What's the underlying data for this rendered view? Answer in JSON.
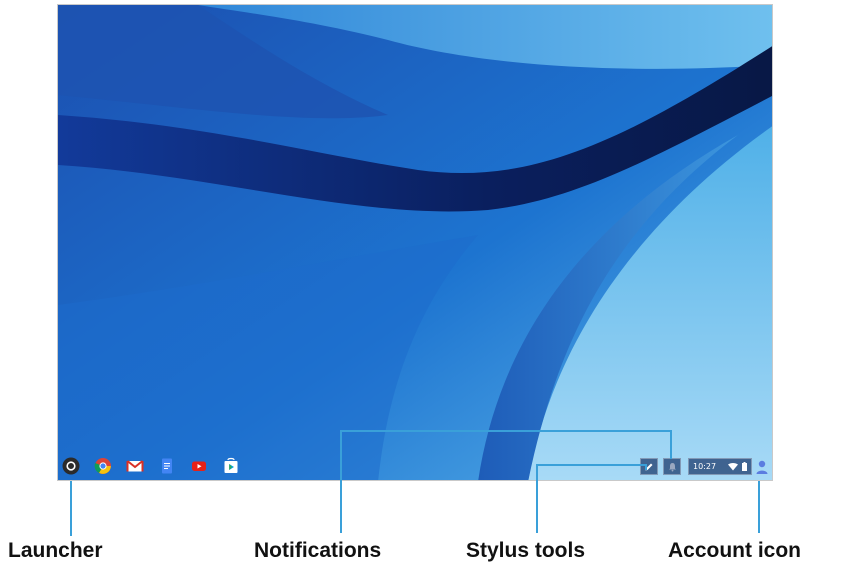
{
  "shelf": {
    "apps": [
      {
        "name": "launcher",
        "icon": "launcher-icon"
      },
      {
        "name": "chrome",
        "icon": "chrome-icon"
      },
      {
        "name": "gmail",
        "icon": "gmail-icon"
      },
      {
        "name": "docs",
        "icon": "docs-icon"
      },
      {
        "name": "youtube",
        "icon": "youtube-icon"
      },
      {
        "name": "play-store",
        "icon": "play-store-icon"
      }
    ]
  },
  "tray": {
    "stylus_icon": "pen-icon",
    "notifications_icon": "bell-icon",
    "time": "10:27",
    "wifi_icon": "wifi-icon",
    "battery_icon": "battery-icon",
    "account_icon": "person-icon"
  },
  "callouts": {
    "launcher": "Launcher",
    "notifications": "Notifications",
    "stylus_tools": "Stylus tools",
    "account_icon": "Account icon"
  },
  "colors": {
    "wallpaper_dark": "#0b2a7a",
    "wallpaper_mid": "#1a66c4",
    "wallpaper_light": "#7cc6ef",
    "callout_line": "#3aa0d9",
    "label_text": "#111111"
  }
}
